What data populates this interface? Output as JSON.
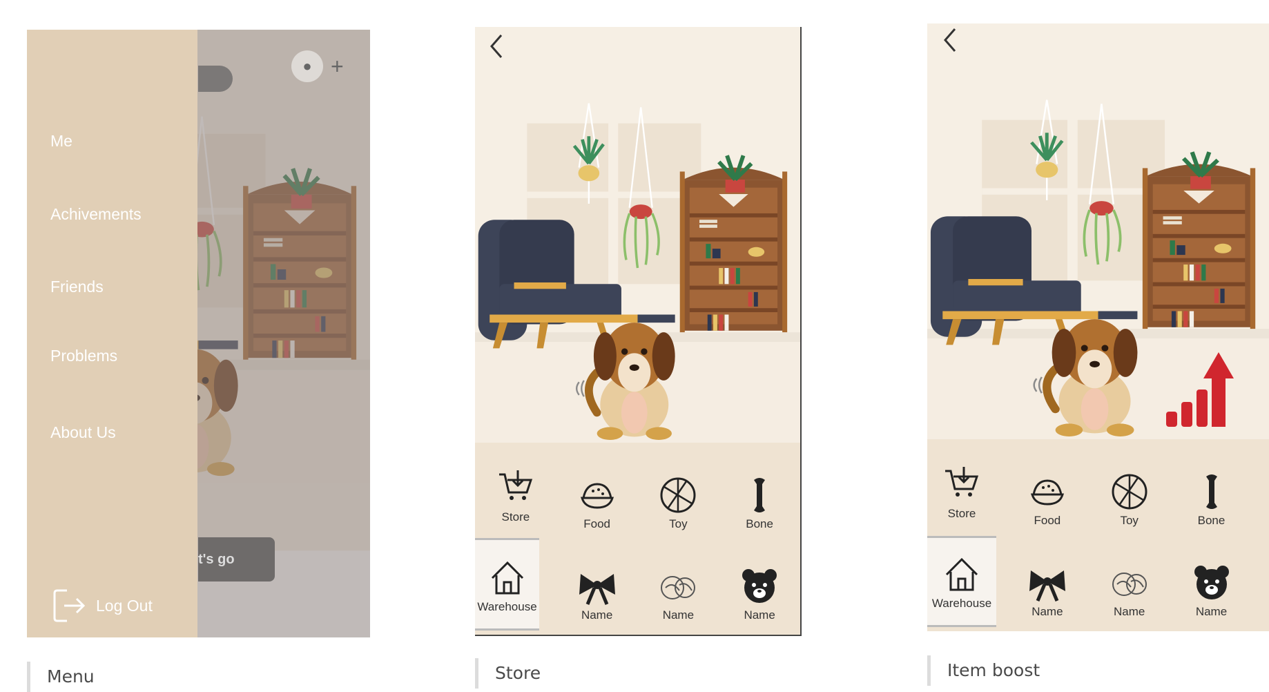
{
  "menu_screen": {
    "items": [
      {
        "label": "Me"
      },
      {
        "label": "Achivements"
      },
      {
        "label": "Friends"
      },
      {
        "label": "Problems"
      },
      {
        "label": "About Us"
      }
    ],
    "logout_label": "Log Out",
    "partial_button_label": "t's go",
    "caption": "Menu"
  },
  "store_screen": {
    "tabs_row1": [
      {
        "label": "Store",
        "icon": "cart-icon"
      },
      {
        "label": "Food",
        "icon": "food-bowl-icon"
      },
      {
        "label": "Toy",
        "icon": "ball-icon"
      },
      {
        "label": "Bone",
        "icon": "bone-icon"
      }
    ],
    "tabs_row2": [
      {
        "label": "Warehouse",
        "icon": "house-icon"
      },
      {
        "label": "Name",
        "icon": "bow-icon"
      },
      {
        "label": "Name",
        "icon": "yarn-icon"
      },
      {
        "label": "Name",
        "icon": "bear-icon"
      }
    ],
    "caption": "Store"
  },
  "boost_screen": {
    "tabs_row1": [
      {
        "label": "Store",
        "icon": "cart-icon"
      },
      {
        "label": "Food",
        "icon": "food-bowl-icon"
      },
      {
        "label": "Toy",
        "icon": "ball-icon"
      },
      {
        "label": "Bone",
        "icon": "bone-icon"
      }
    ],
    "tabs_row2": [
      {
        "label": "Warehouse",
        "icon": "house-icon"
      },
      {
        "label": "Name",
        "icon": "bow-icon"
      },
      {
        "label": "Name",
        "icon": "yarn-icon"
      },
      {
        "label": "Name",
        "icon": "bear-icon"
      }
    ],
    "caption": "Item boost"
  },
  "colors": {
    "menu_panel": "#e1cfb6",
    "room_wall": "#f6efe4",
    "tab_bar": "#efe3d2",
    "boost_arrow": "#d0262e",
    "sofa": "#3d4458",
    "shelf": "#8b5530"
  }
}
